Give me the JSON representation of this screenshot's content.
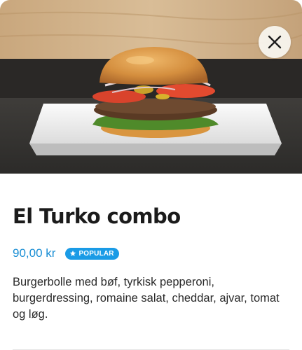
{
  "product": {
    "title": "El Turko combo",
    "price": "90,00 kr",
    "badge": "POPULAR",
    "description": "Burgerbolle med bøf, tyrkisk pepperoni, burgerdressing, romaine salat, cheddar, ajvar, tomat og løg."
  },
  "icons": {
    "close": "close-icon",
    "badge_star": "star-icon"
  },
  "colors": {
    "accent": "#1a8ed4",
    "badge_bg": "#1a9be6"
  }
}
